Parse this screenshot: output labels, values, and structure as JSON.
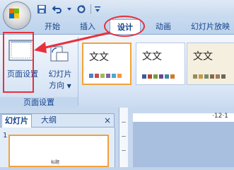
{
  "qat": {
    "icons": [
      "save-icon",
      "undo-icon",
      "redo-icon"
    ]
  },
  "tabs": [
    "开始",
    "插入",
    "设计",
    "动画",
    "幻灯片放映"
  ],
  "active_tab_index": 2,
  "ribbon": {
    "page_setup": {
      "setup_label": "页面设置",
      "orientation_line1": "幻灯片",
      "orientation_line2": "方向",
      "group_label": "页面设置"
    },
    "themes": [
      {
        "text": "文文",
        "selected": true
      },
      {
        "text": "文文",
        "selected": false
      },
      {
        "text": "文文",
        "selected": false
      }
    ]
  },
  "panel": {
    "tab_slides": "幻灯片",
    "tab_outline": "大纲",
    "close": "×",
    "slide_number": "1",
    "slide_thumb_text": "标题"
  },
  "ruler_text": "·12·1"
}
